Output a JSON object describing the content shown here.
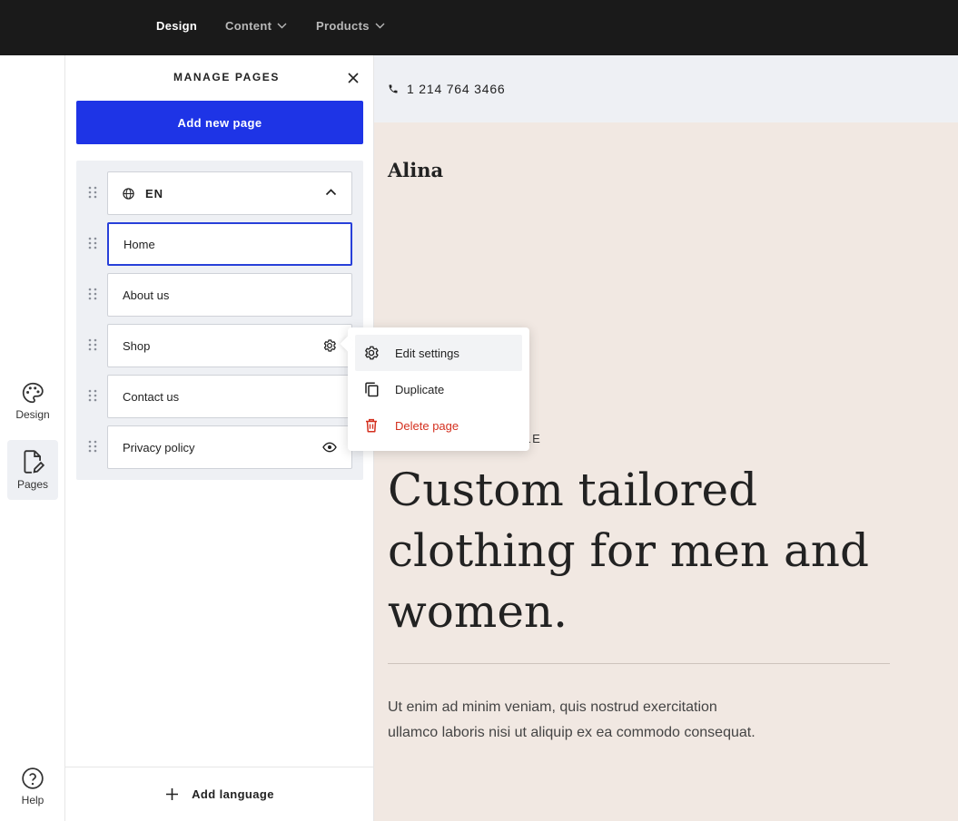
{
  "topbar": {
    "nav": [
      {
        "label": "Design",
        "active": true
      },
      {
        "label": "Content",
        "has_dropdown": true
      },
      {
        "label": "Products",
        "has_dropdown": true
      }
    ]
  },
  "rail": {
    "design_label": "Design",
    "pages_label": "Pages",
    "help_label": "Help"
  },
  "panel": {
    "title": "MANAGE PAGES",
    "add_page_label": "Add new page",
    "language": "EN",
    "pages": [
      {
        "label": "Home",
        "selected": true
      },
      {
        "label": "About us"
      },
      {
        "label": "Shop",
        "icon": "gear-icon"
      },
      {
        "label": "Contact us"
      },
      {
        "label": "Privacy policy",
        "icon": "eye-icon"
      }
    ],
    "add_language_label": "Add language"
  },
  "context_menu": {
    "items": [
      {
        "label": "Edit settings",
        "icon": "gear-icon"
      },
      {
        "label": "Duplicate",
        "icon": "copy-icon"
      },
      {
        "label": "Delete page",
        "icon": "trash-icon",
        "color": "#d4301f"
      }
    ]
  },
  "preview": {
    "phone": "1 214 764 3466",
    "brand": "Alina",
    "eyebrow_visible": "YLE",
    "headline": "Custom tailored clothing for men and women.",
    "body_line1": "Ut enim ad minim veniam, quis nostrud exercitation",
    "body_line2": "ullamco laboris nisi ut aliquip ex ea commodo consequat."
  },
  "colors": {
    "accent": "#1e34e6",
    "topbar": "#1a1a1a",
    "preview_bg": "#f1e8e2",
    "danger": "#d4301f"
  }
}
